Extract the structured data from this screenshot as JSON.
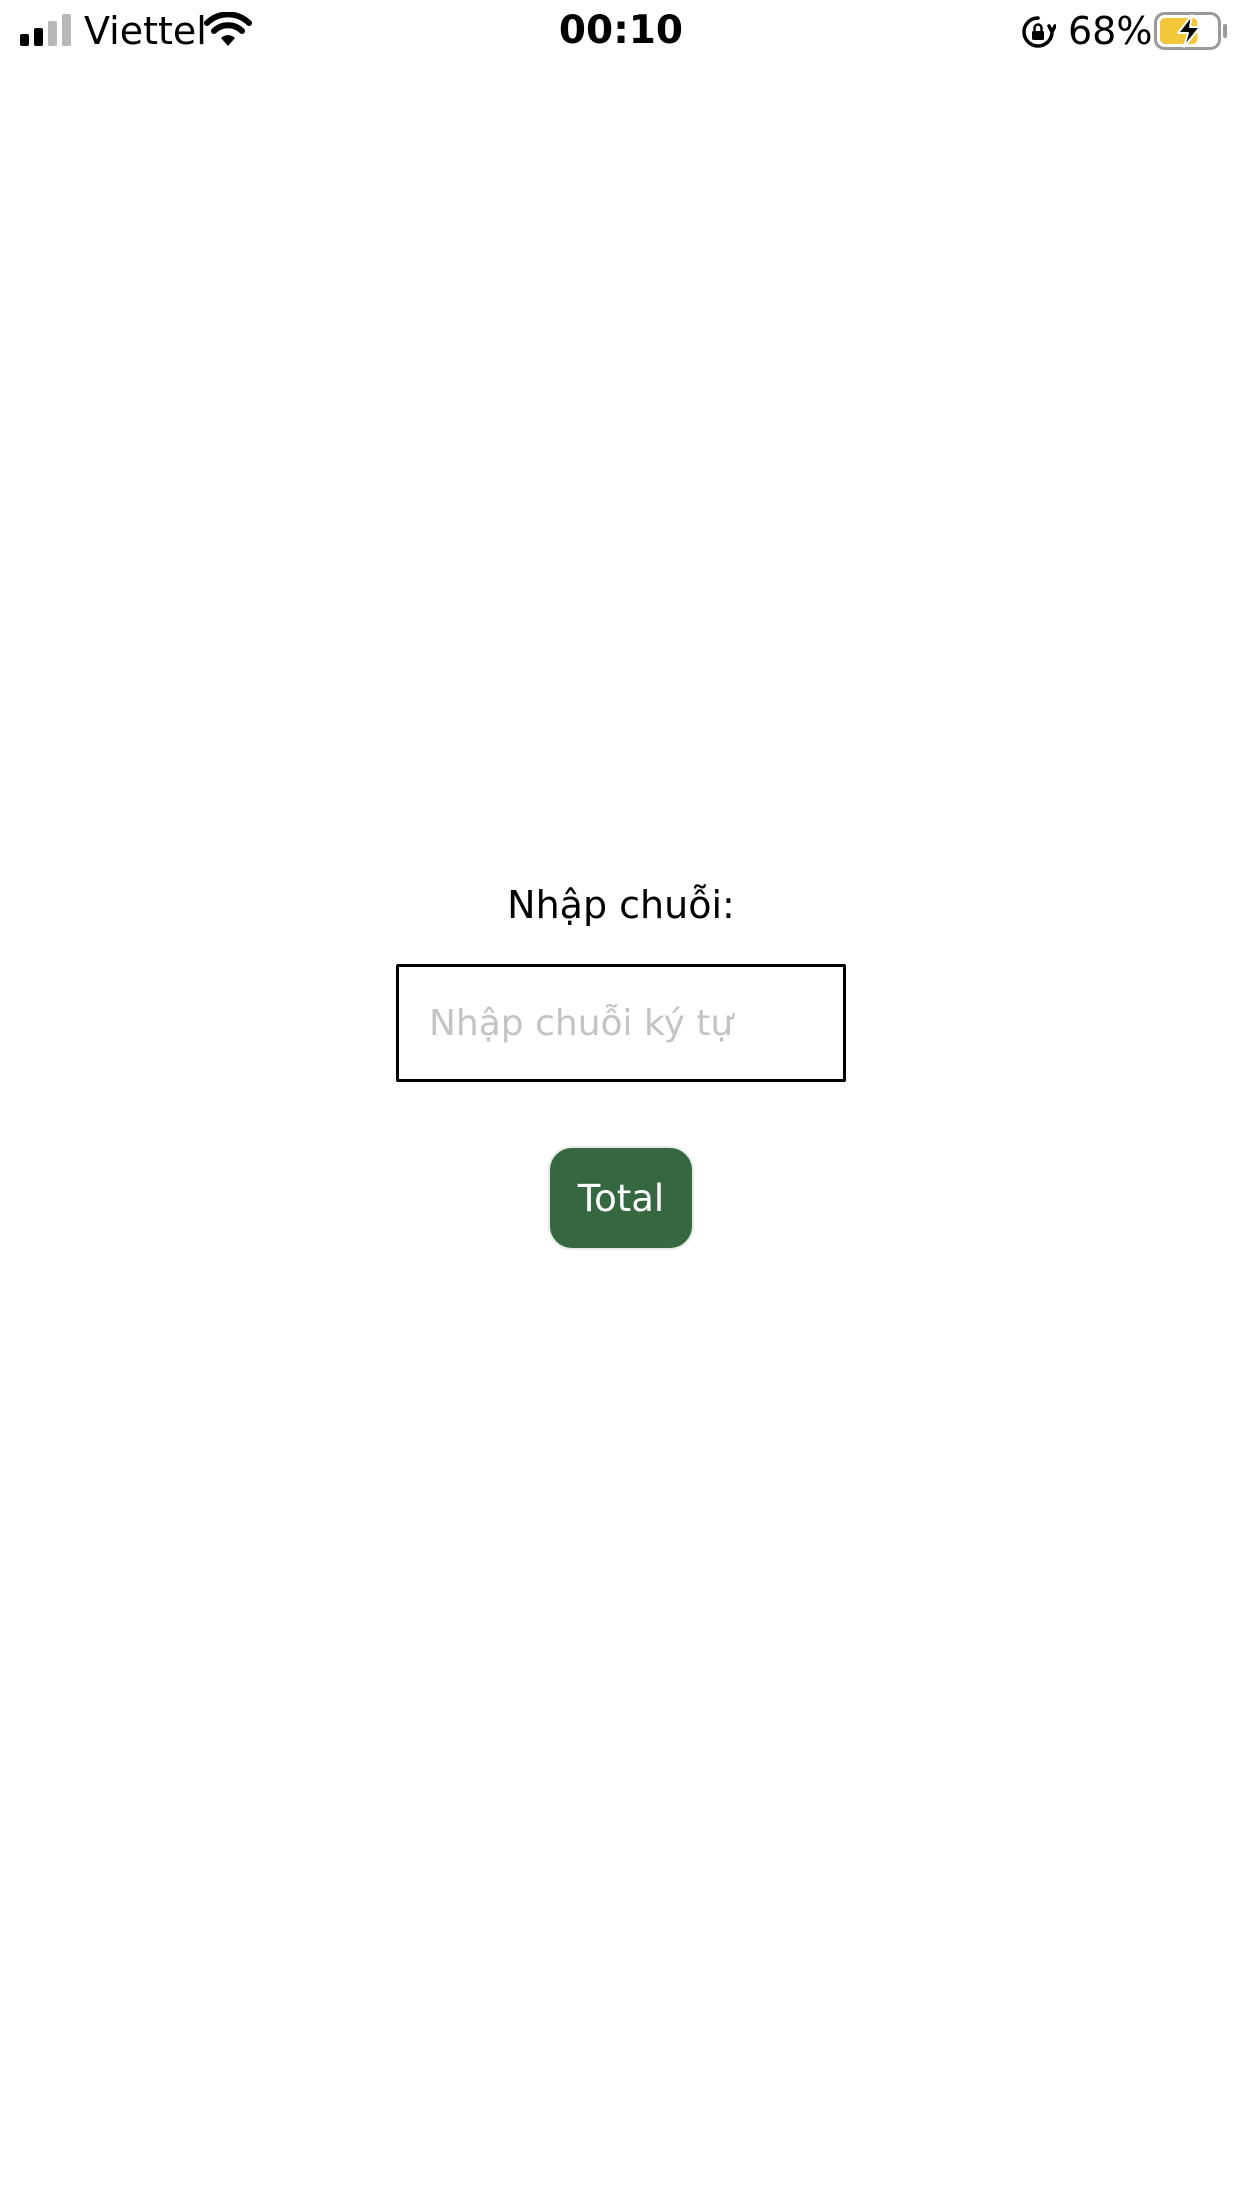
{
  "status_bar": {
    "carrier": "Viettel",
    "time": "00:10",
    "battery_percent": "68%",
    "signal_icon": "cellular-signal-icon",
    "wifi_icon": "wifi-icon",
    "orientation_lock_icon": "orientation-lock-icon",
    "battery_icon": "battery-charging-icon",
    "battery_fill_fraction": 0.68,
    "battery_color": "#F3C73A"
  },
  "form": {
    "label": "Nhập chuỗi:",
    "input_placeholder": "Nhập chuỗi ký tự",
    "input_value": "",
    "button_label": "Total",
    "button_color": "#356840"
  }
}
